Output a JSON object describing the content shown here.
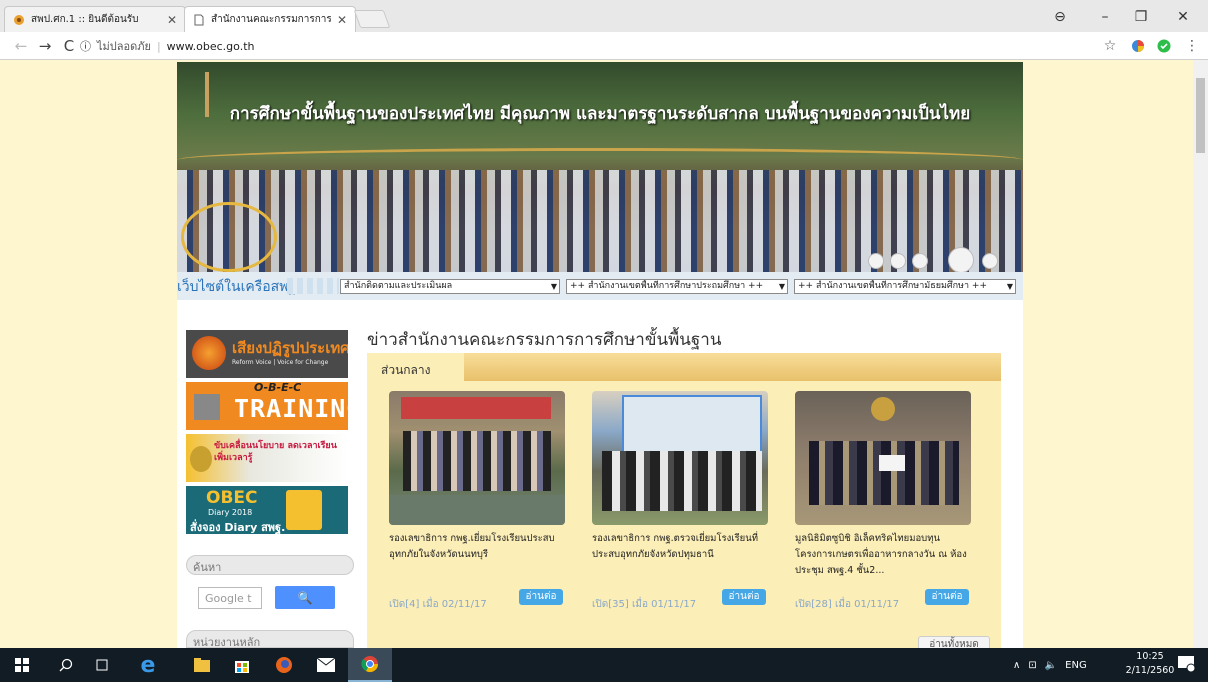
{
  "browser": {
    "tabs": [
      {
        "title": "สพป.ศก.1 :: ยินดีต้อนรับ",
        "active": false
      },
      {
        "title": "สำนักงานคณะกรรมการการศึ",
        "active": true
      }
    ],
    "tab_close": "✕",
    "address": {
      "security_label": "ไม่ปลอดภัย",
      "url": "www.obec.go.th"
    }
  },
  "page": {
    "banner_tagline": "การศึกษาขั้นพื้นฐานของประเทศไทย มีคุณภาพ และมาตรฐานระดับสากล บนพื้นฐานของความเป็นไทย",
    "network": {
      "label": "เว็บไซต์ในเครือสพฐ.",
      "selects": [
        "สำนักติดตามและประเมินผล",
        "++ สำนักงานเขตพื้นที่การศึกษาประถมศึกษา ++",
        "++ สำนักงานเขตพื้นที่การศึกษามัธยมศึกษา ++"
      ]
    },
    "sidebar": {
      "banners": [
        {
          "text": "เสียงปฏิรูปประเทศ",
          "sub": "Reform Voice | Voice for Change"
        },
        {
          "text": "TRAINING",
          "sub": "O-B-E-C"
        },
        {
          "text": "ขับเคลื่อนนโยบาย ลดเวลาเรียน เพิ่มเวลารู้",
          "sub": ""
        },
        {
          "text": "สั่งจอง Diary สพฐ.",
          "sub": "Diary 2018"
        }
      ],
      "search_label": "ค้นหา",
      "google_placeholder": "Google t",
      "search_button": "🔍",
      "main_units_label": "หน่วยงานหลัก"
    },
    "news": {
      "title": "ข่าวสำนักงานคณะกรรมการการศึกษาขั้นพื้นฐาน",
      "tab": "ส่วนกลาง",
      "items": [
        {
          "caption": "รองเลขาธิการ กพฐ.เยี่ยมโรงเรียนประสบอุทกภัยในจังหวัดนนทบุรี",
          "meta": "เปิด[4] เมื่อ 02/11/17",
          "more": "อ่านต่อ"
        },
        {
          "caption": "รองเลขาธิการ กพฐ.ตรวจเยี่ยมโรงเรียนที่ประสบอุทกภัยจังหวัดปทุมธานี",
          "meta": "เปิด[35] เมื่อ 01/11/17",
          "more": "อ่านต่อ"
        },
        {
          "caption": "มูลนิธิมิตซูบิชิ อิเล็คทริคไทยมอบทุนโครงการเกษตรเพื่ออาหารกลางวัน ณ ห้องประชุม สพฐ.4 ชั้น2...",
          "meta": "เปิด[28] เมื่อ 01/11/17",
          "more": "อ่านต่อ"
        }
      ],
      "all_button": "อ่านทั้งหมด"
    }
  },
  "taskbar": {
    "tray_lang": "ENG",
    "time": "10:25",
    "date": "2/11/2560"
  }
}
